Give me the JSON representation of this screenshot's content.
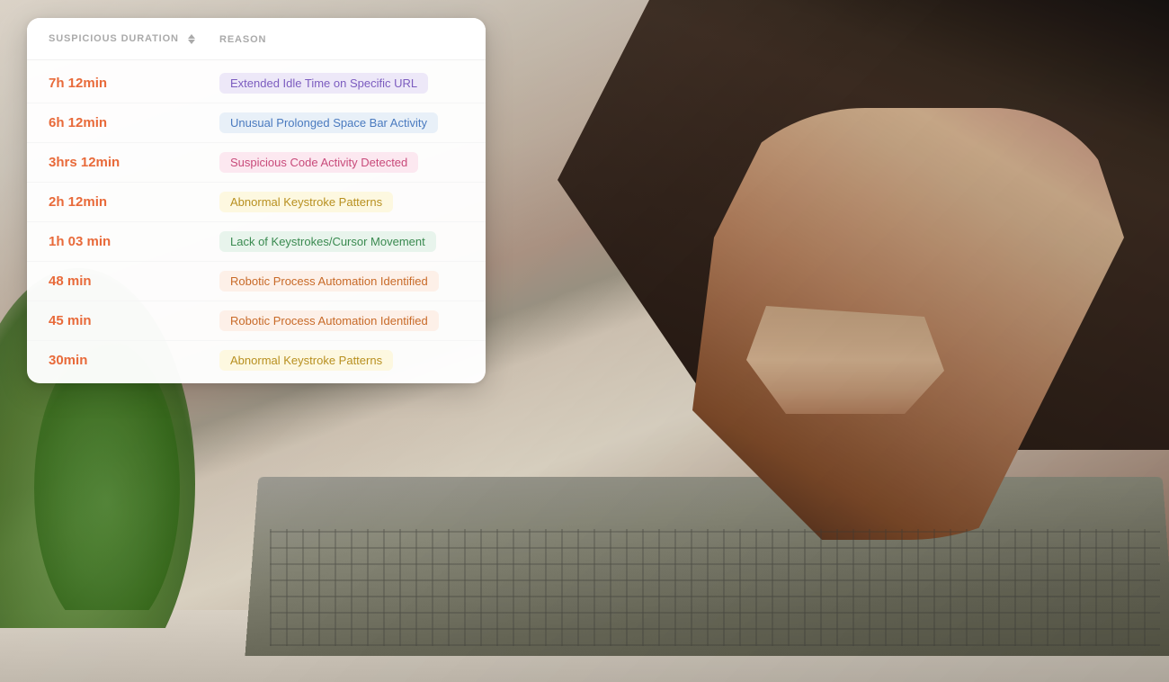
{
  "background": {
    "description": "Person pointing at laptop keyboard, office setting"
  },
  "table": {
    "headers": {
      "duration_label": "SUSPICIOUS DURATION",
      "reason_label": "REASON"
    },
    "rows": [
      {
        "duration": "7h 12min",
        "reason": "Extended Idle Time on Specific URL",
        "badge_class": "badge-purple"
      },
      {
        "duration": "6h 12min",
        "reason": "Unusual Prolonged Space Bar Activity",
        "badge_class": "badge-blue"
      },
      {
        "duration": "3hrs 12min",
        "reason": "Suspicious Code Activity Detected",
        "badge_class": "badge-pink"
      },
      {
        "duration": "2h 12min",
        "reason": "Abnormal Keystroke Patterns",
        "badge_class": "badge-yellow"
      },
      {
        "duration": "1h 03 min",
        "reason": "Lack of Keystrokes/Cursor Movement",
        "badge_class": "badge-green"
      },
      {
        "duration": "48 min",
        "reason": "Robotic Process Automation Identified",
        "badge_class": "badge-orange"
      },
      {
        "duration": "45 min",
        "reason": "Robotic Process Automation Identified",
        "badge_class": "badge-orange"
      },
      {
        "duration": "30min",
        "reason": "Abnormal Keystroke Patterns",
        "badge_class": "badge-yellow"
      }
    ]
  }
}
